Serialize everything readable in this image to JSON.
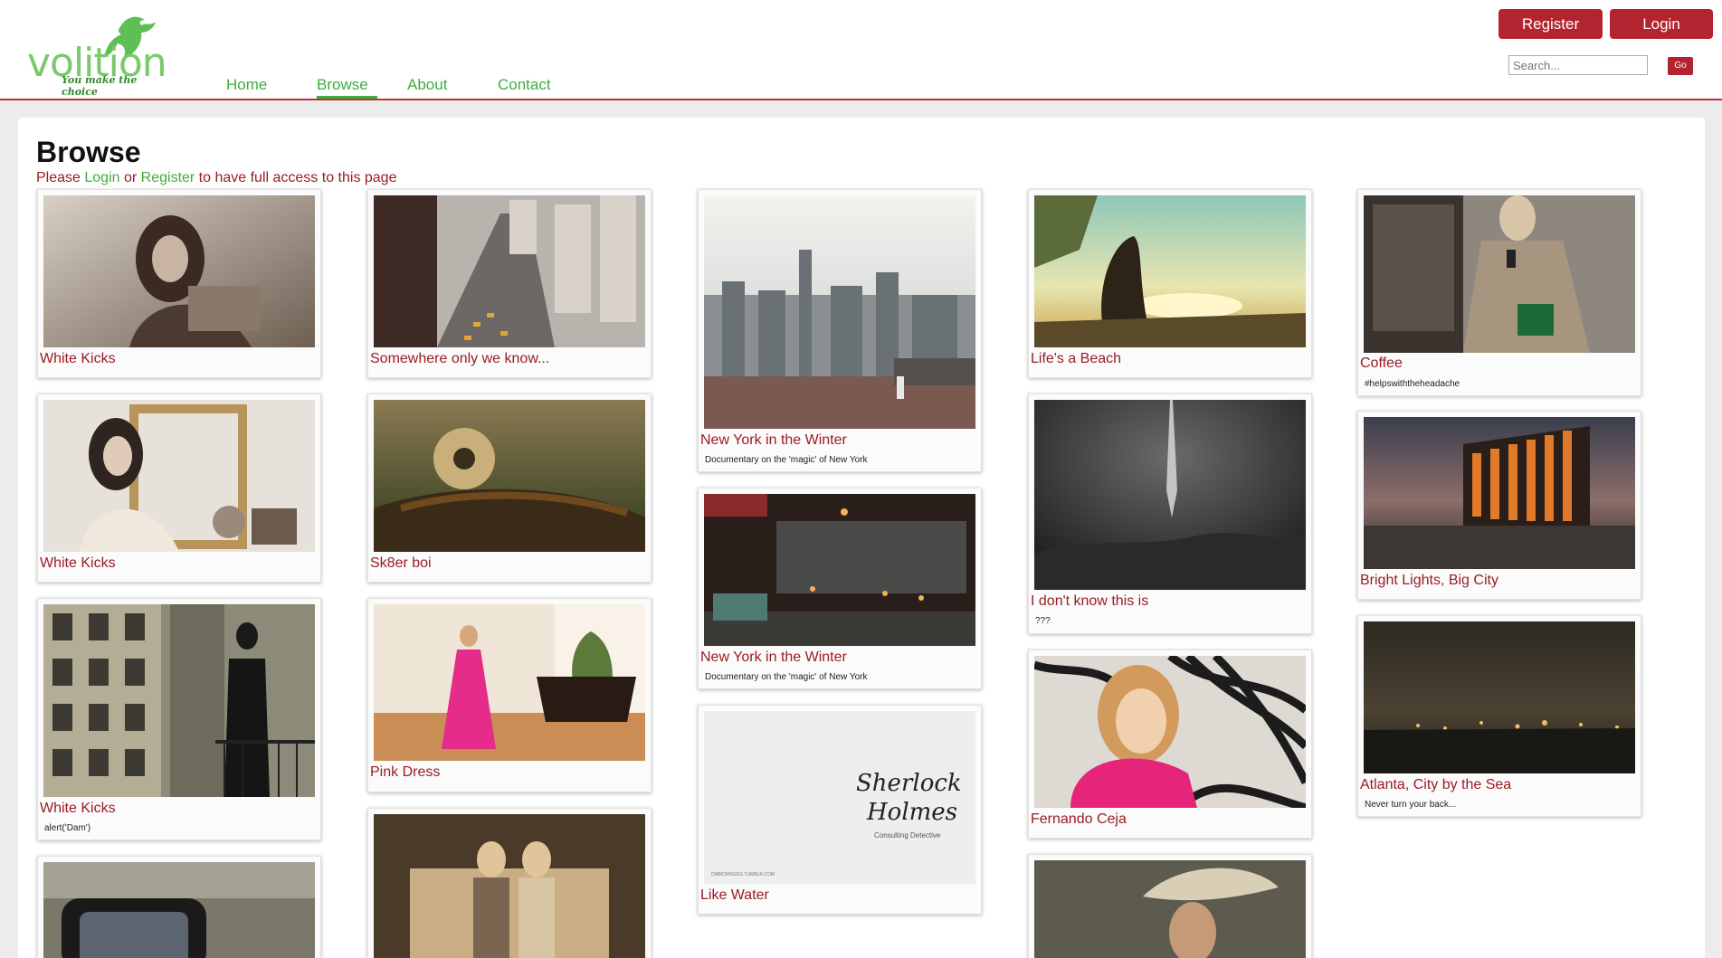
{
  "logo": {
    "word": "volition",
    "tagline": "You make the choice"
  },
  "nav": [
    {
      "label": "Home"
    },
    {
      "label": "Browse"
    },
    {
      "label": "About"
    },
    {
      "label": "Contact"
    }
  ],
  "auth": {
    "register": "Register",
    "login": "Login"
  },
  "search": {
    "placeholder": "Search...",
    "go": "Go"
  },
  "page": {
    "title": "Browse",
    "note_pre": "Please ",
    "note_login": "Login",
    "note_or": " or ",
    "note_register": "Register",
    "note_post": " to have full access to this page"
  },
  "cards": [
    {
      "title": "White Kicks",
      "desc": ""
    },
    {
      "title": "White Kicks",
      "desc": ""
    },
    {
      "title": "White Kicks",
      "desc": "alert('Dam')"
    },
    {
      "title": "",
      "desc": ""
    },
    {
      "title": "Somewhere only we know...",
      "desc": ""
    },
    {
      "title": "Sk8er boi",
      "desc": ""
    },
    {
      "title": "Pink Dress",
      "desc": ""
    },
    {
      "title": "",
      "desc": ""
    },
    {
      "title": "New York in the Winter",
      "desc": "Documentary on the 'magic' of New York"
    },
    {
      "title": "New York in the Winter",
      "desc": "Documentary on the 'magic' of New York"
    },
    {
      "title": "Like Water",
      "desc": "",
      "image_text": [
        "Sherlock",
        "Holmes",
        "Consulting Detective",
        "DMMCMSGIES.TUMBLR.COM"
      ]
    },
    {
      "title": "Life's a Beach",
      "desc": ""
    },
    {
      "title": "I don't know this is",
      "desc": "???"
    },
    {
      "title": "Fernando Ceja",
      "desc": ""
    },
    {
      "title": "",
      "desc": ""
    },
    {
      "title": "Coffee",
      "desc": "#helpswiththeheadache"
    },
    {
      "title": "Bright Lights, Big City",
      "desc": ""
    },
    {
      "title": "Atlanta, City by the Sea",
      "desc": "Never turn your back..."
    }
  ],
  "colors": {
    "accent": "#b32430",
    "link": "#3fae3c",
    "title": "#9b1c24"
  }
}
